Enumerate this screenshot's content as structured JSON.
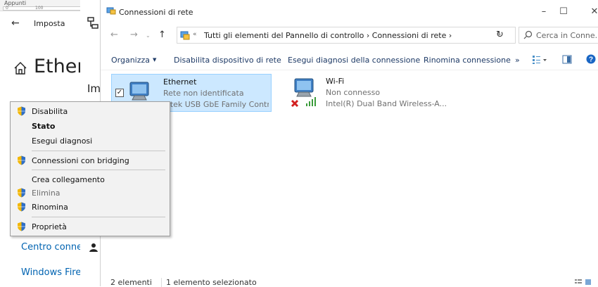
{
  "ruler": {
    "label": "Appunti",
    "tick_start": "0",
    "tick_mid": "100"
  },
  "settings": {
    "title": "Imposta",
    "heading": "Ether",
    "links": [
      "Centro conne",
      "Windows Fire"
    ]
  },
  "strip": {
    "text": "Im"
  },
  "explorer": {
    "title": "Connessioni di rete",
    "address": {
      "sep": "«",
      "path": "Tutti gli elementi del Pannello di controllo  ›  Connessioni di rete  ›"
    },
    "search_placeholder": "Cerca in Conne...",
    "commands": {
      "organize": "Organizza",
      "disable": "Disabilita dispositivo di rete",
      "diagnose": "Esegui diagnosi della connessione",
      "rename": "Rinomina connessione",
      "more": "»"
    },
    "items": [
      {
        "name": "Ethernet",
        "status": "Rete non identificata",
        "adapter": "altek USB GbE Family Contr..."
      },
      {
        "name": "Wi-Fi",
        "status": "Non connesso",
        "adapter": "Intel(R) Dual Band Wireless-A..."
      }
    ],
    "status": {
      "count": "2 elementi",
      "selected": "1 elemento selezionato"
    }
  },
  "context_menu": {
    "items": [
      {
        "label": "Disabilita",
        "icon": "shield-icon"
      },
      {
        "label": "Stato"
      },
      {
        "label": "Esegui diagnosi"
      },
      {
        "label": "Connessioni con bridging",
        "icon": "shield-icon"
      },
      {
        "label": "Crea collegamento"
      },
      {
        "label": "Elimina",
        "icon": "shield-icon"
      },
      {
        "label": "Rinomina",
        "icon": "shield-icon"
      },
      {
        "label": "Proprietà",
        "icon": "shield-icon"
      }
    ]
  },
  "colors": {
    "selection": "#cce8ff",
    "link": "#0063b1",
    "command": "#1e3a66"
  }
}
